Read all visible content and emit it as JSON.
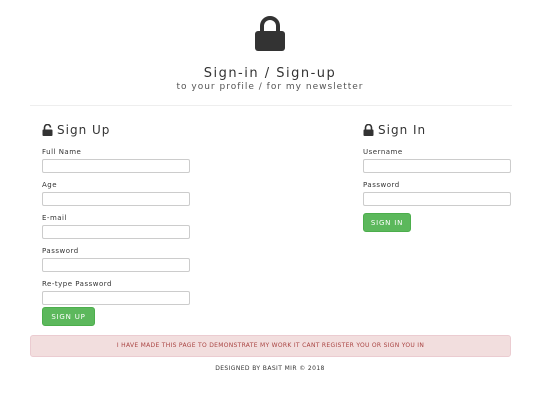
{
  "header": {
    "title": "Sign-in / Sign-up",
    "subtitle": "to your profile / for my newsletter"
  },
  "signup": {
    "heading": "Sign Up",
    "fields": [
      {
        "label": "Full Name",
        "value": "",
        "placeholder": ""
      },
      {
        "label": "Age",
        "value": "",
        "placeholder": ""
      },
      {
        "label": "E-mail",
        "value": "",
        "placeholder": ""
      },
      {
        "label": "Password",
        "value": "",
        "placeholder": ""
      },
      {
        "label": "Re-type Password",
        "value": "",
        "placeholder": ""
      }
    ],
    "button_label": "SIGN UP"
  },
  "signin": {
    "heading": "Sign In",
    "fields": [
      {
        "label": "Username",
        "value": "",
        "placeholder": ""
      },
      {
        "label": "Password",
        "value": "",
        "placeholder": ""
      }
    ],
    "button_label": "SIGN IN"
  },
  "alert": {
    "text": "I HAVE MADE THIS PAGE TO DEMONSTRATE MY WORK IT CANT REGISTER YOU OR SIGN YOU IN"
  },
  "footer": {
    "text": "DESIGNED BY BASIT MIR © 2018"
  },
  "icons": {
    "header_icon": "lock-icon",
    "signup_icon": "unlock-icon",
    "signin_icon": "lock-icon"
  },
  "colors": {
    "button": "#5cb85c",
    "alert_background": "#f2dede",
    "alert_text": "#a94442",
    "icon": "#333333"
  }
}
